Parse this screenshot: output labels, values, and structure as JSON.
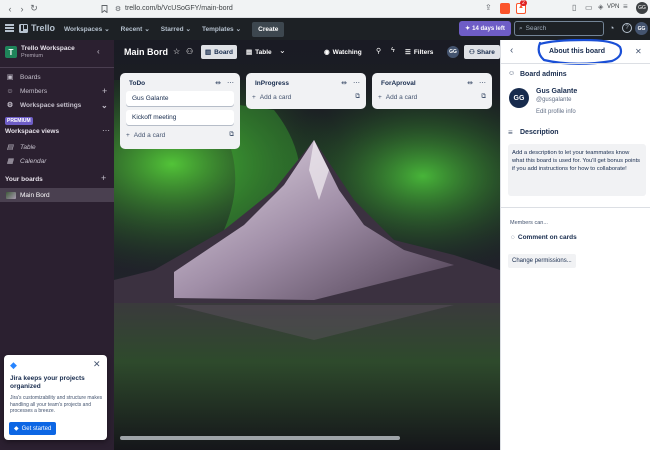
{
  "browser": {
    "url": "trello.com/b/VcUSoGFY/main-bord",
    "vpn_label": "VPN",
    "profile_initials": "GG",
    "notif_count": "2"
  },
  "header": {
    "logo_text": "Trello",
    "menus": [
      "Workspaces",
      "Recent",
      "Starred",
      "Templates"
    ],
    "create_label": "Create",
    "trial_label": "14 days left",
    "search_placeholder": "Search",
    "avatar_initials": "GG"
  },
  "sidebar": {
    "workspace_initial": "T",
    "workspace_name": "Trello Workspace",
    "workspace_plan": "Premium",
    "items": [
      {
        "label": "Boards",
        "icon": "boards-icon"
      },
      {
        "label": "Members",
        "icon": "members-icon"
      },
      {
        "label": "Workspace settings",
        "icon": "settings-icon"
      }
    ],
    "premium_badge": "PREMIUM",
    "views_heading": "Workspace views",
    "views": [
      {
        "label": "Table",
        "icon": "table-icon"
      },
      {
        "label": "Calendar",
        "icon": "calendar-icon"
      }
    ],
    "boards_heading": "Your boards",
    "boards": [
      {
        "label": "Main Bord"
      }
    ]
  },
  "boardbar": {
    "title": "Main Bord",
    "board_view": "Board",
    "table_view": "Table",
    "watching": "Watching",
    "filters": "Filters",
    "share": "Share",
    "member_initials": "GG"
  },
  "lists": [
    {
      "title": "ToDo",
      "cards": [
        "Gus Galante",
        "Kickoff meeting"
      ],
      "add_label": "Add a card"
    },
    {
      "title": "InProgress",
      "cards": [],
      "add_label": "Add a card"
    },
    {
      "title": "ForAproval",
      "cards": [],
      "add_label": "Add a card"
    }
  ],
  "panel": {
    "title": "About this board",
    "admins_heading": "Board admins",
    "admin_initials": "GG",
    "admin_name": "Gus Galante",
    "admin_handle": "@gusgalante",
    "edit_profile": "Edit profile info",
    "description_heading": "Description",
    "description_text": "Add a description to let your teammates know what this board is used for. You'll get bonus points if you add instructions for how to collaborate!",
    "members_can": "Members can...",
    "comment_label": "Comment on cards",
    "change_permissions": "Change permissions..."
  },
  "jira_popup": {
    "title": "Jira keeps your projects organized",
    "body": "Jira's customizability and structure makes handling all your team's projects and processes a breeze.",
    "button": "Get started"
  },
  "colors": {
    "header_bg": "#1d2125",
    "sidebar_bg": "#2b2030",
    "trial_purple": "#6e5dc6",
    "primary_blue": "#0c66e4",
    "annotation_blue": "#1a4fd6"
  }
}
